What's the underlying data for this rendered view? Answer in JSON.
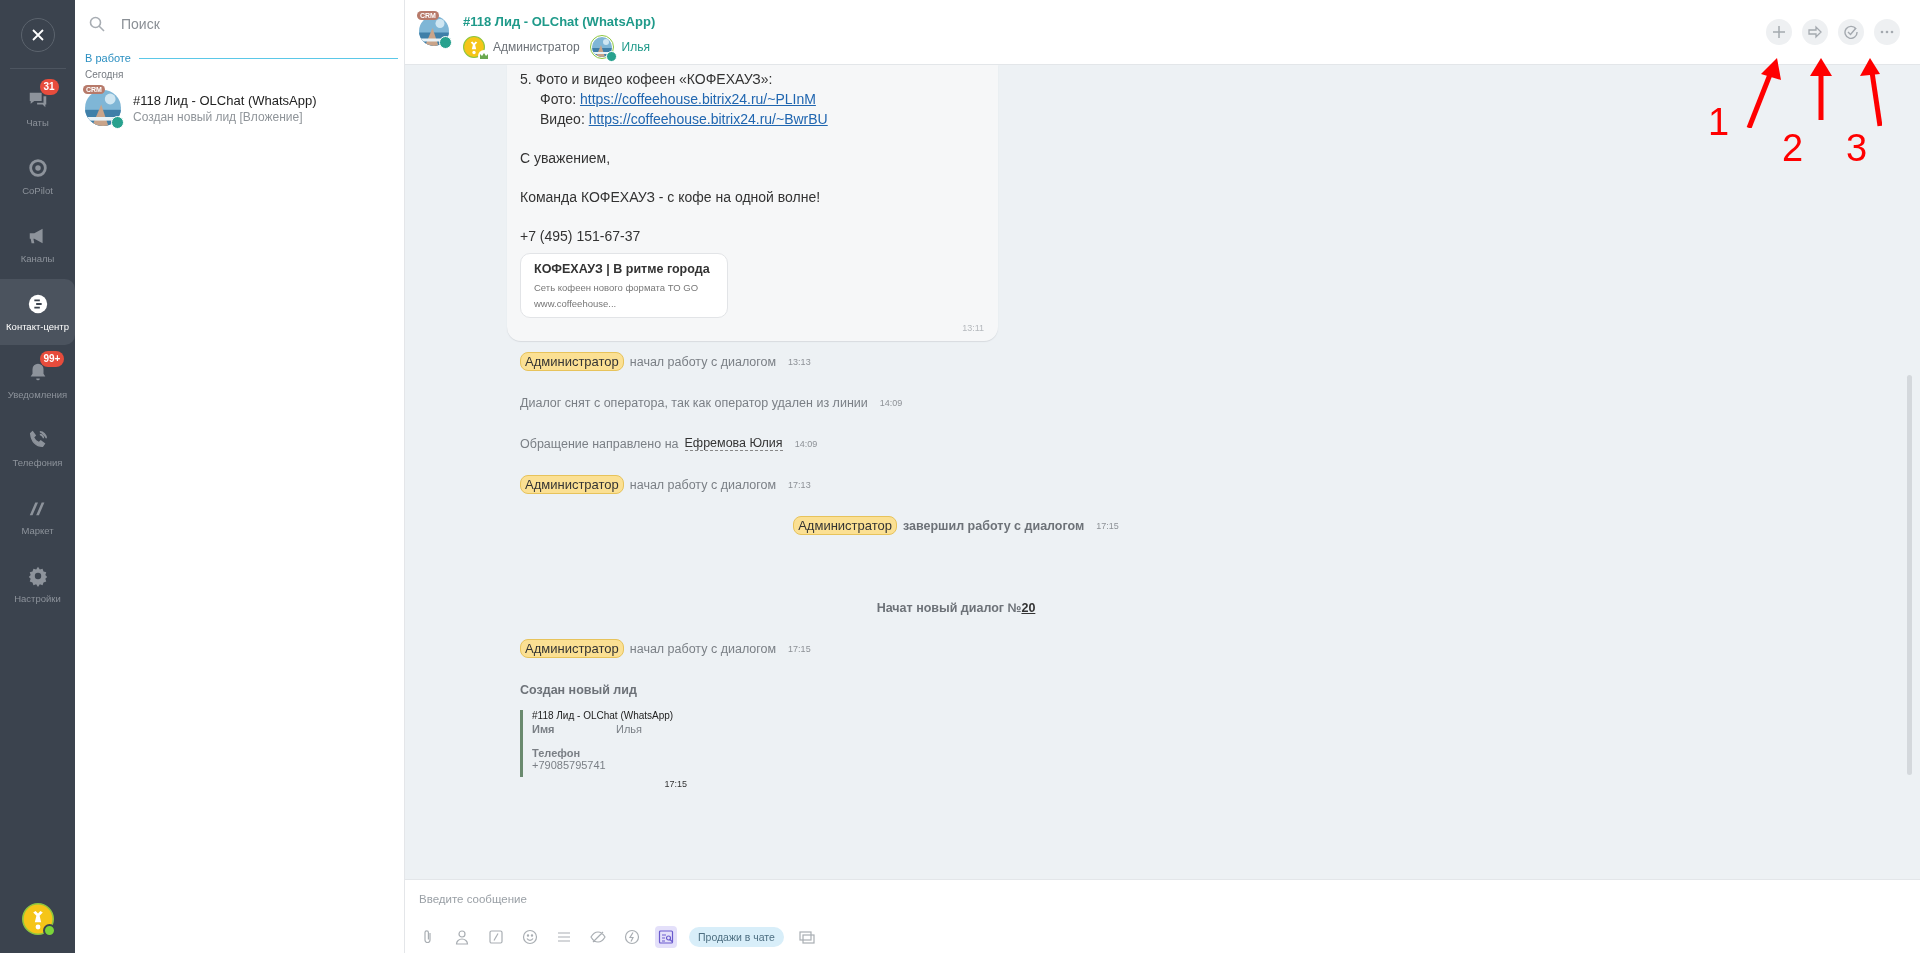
{
  "nav": {
    "items": [
      {
        "label": "Чаты",
        "badge": "31",
        "selected": false
      },
      {
        "label": "CoPilot",
        "selected": false
      },
      {
        "label": "Каналы",
        "selected": false
      },
      {
        "label": "Контакт-центр",
        "selected": true
      },
      {
        "label": "Уведомления",
        "badge": "99+",
        "selected": false
      },
      {
        "label": "Телефония",
        "selected": false
      },
      {
        "label": "Маркет",
        "selected": false
      },
      {
        "label": "Настройки",
        "selected": false
      }
    ]
  },
  "chat_list": {
    "search": {
      "placeholder": "Поиск"
    },
    "section": "В работе",
    "day": "Сегодня",
    "items": [
      {
        "badge": "CRM",
        "title": "#118 Лид - OLChat (WhatsApp)",
        "preview": "Создан новый лид [Вложение]"
      }
    ]
  },
  "header": {
    "badge": "CRM",
    "title": "#118 Лид - OLChat (WhatsApp)",
    "participants": [
      {
        "name": "Администратор",
        "kind": "admin"
      },
      {
        "name": "Илья",
        "kind": "client"
      }
    ]
  },
  "annotations": [
    "1",
    "2",
    "3"
  ],
  "bubble": {
    "heading": "5. Фото и видео кофеен «КОФЕХАУЗ»:",
    "links": [
      {
        "label": "Фото:",
        "url": "https://coffeehouse.bitrix24.ru/~PLInM"
      },
      {
        "label": "Видео:",
        "url": "https://coffeehouse.bitrix24.ru/~BwrBU"
      }
    ],
    "paragraphs": [
      "С уважением,",
      "Команда КОФЕХАУЗ - с кофе на одной волне!",
      "+7 (495) 151-67-37"
    ],
    "preview": {
      "title": "КОФЕХАУЗ | В ритме города",
      "description": "Сеть кофеен нового формата TO GO",
      "site": "www.coffeehouse..."
    },
    "time": "13:11"
  },
  "events": [
    {
      "kind": "started",
      "name": "Администратор",
      "text": "начал работу с диалогом",
      "time": "13:13"
    },
    {
      "kind": "plain",
      "text": "Диалог снят с оператора, так как оператор удален из линии",
      "time": "14:09"
    },
    {
      "kind": "forwarded",
      "text": "Обращение направлено на",
      "name": "Ефремова Юлия",
      "time": "14:09"
    },
    {
      "kind": "started",
      "name": "Администратор",
      "text": "начал работу с диалогом",
      "time": "17:13"
    },
    {
      "kind": "finished",
      "name": "Администратор",
      "text": "завершил работу с диалогом",
      "time": "17:15"
    },
    {
      "kind": "new_dialog",
      "text": "Начат новый диалог №",
      "number": "20"
    },
    {
      "kind": "started",
      "name": "Администратор",
      "text": "начал работу с диалогом",
      "time": "17:15"
    },
    {
      "kind": "lead",
      "title": "Создан новый лид",
      "card_title": "#118 Лид - OLChat (WhatsApp)",
      "fields": [
        {
          "label": "Имя",
          "value": "Илья"
        },
        {
          "label": "Телефон",
          "value": "+79085795741"
        }
      ],
      "time": "17:15"
    }
  ],
  "composer": {
    "placeholder": "Введите сообщение",
    "tools": [
      {
        "selected": false
      },
      {
        "selected": false
      },
      {
        "selected": false
      },
      {
        "selected": false
      },
      {
        "selected": false
      },
      {
        "selected": false
      },
      {
        "selected": false
      },
      {
        "selected": true
      }
    ],
    "chip": "Продажи в чате"
  }
}
